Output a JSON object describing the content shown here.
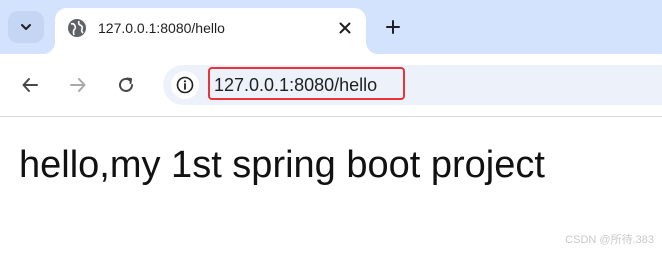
{
  "tabstrip": {
    "search_icon": "chevron-down-icon",
    "tab": {
      "favicon": "globe-icon",
      "title": "127.0.0.1:8080/hello",
      "close_icon": "close-icon"
    },
    "new_tab_icon": "plus-icon",
    "colors": {
      "strip_bg": "#d3e3fd",
      "tab_bg": "#ffffff"
    }
  },
  "toolbar": {
    "back_icon": "arrow-left-icon",
    "forward_icon": "arrow-right-icon",
    "reload_icon": "reload-icon",
    "site_info_icon": "info-icon",
    "url": "127.0.0.1:8080/hello",
    "colors": {
      "omnibox_bg": "#edf2fa",
      "highlight_border": "#e8343a"
    }
  },
  "page": {
    "heading": "hello,my 1st spring boot project"
  },
  "watermark": "CSDN @所待.383"
}
